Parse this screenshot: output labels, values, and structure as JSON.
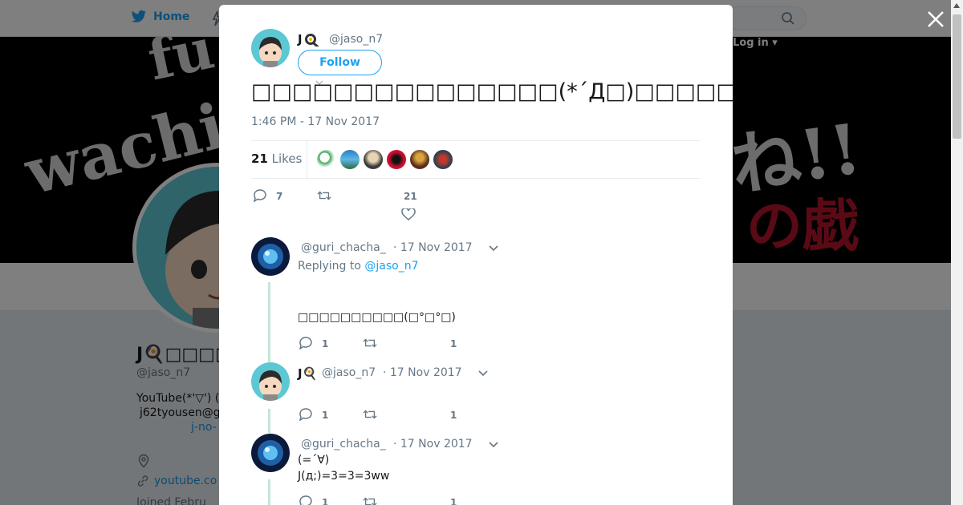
{
  "topbar": {
    "home_label": "Home",
    "login_label": "Log in"
  },
  "banner": {
    "scribble_1": "wachi",
    "scribble_2": "ね!!",
    "scribble_3": "の戯言",
    "scribble_4": "fu"
  },
  "background_profile": {
    "name": "J",
    "handle": "@jaso_n7",
    "bio_line1": "YouTube(*'▽') (",
    "bio_line2": "j62tyousen@g",
    "link_fragment": "j-no-",
    "url_fragment": "youtube.co",
    "joined_fragment": "Joined Febru"
  },
  "tweet": {
    "author_name": "J",
    "author_handle": "@jaso_n7",
    "follow_label": "Follow",
    "text": "□□□□□□□□□□□□□□□(*´Д□)□□□□□□□□□□□□□□□□□( ˘•ω",
    "timestamp": "1:46 PM - 17 Nov 2017",
    "likes_count": "21",
    "likes_label": "Likes",
    "reply_count": "7",
    "like_count": "21"
  },
  "replies": [
    {
      "handle": "@guri_chacha_",
      "date": "· 17 Nov 2017",
      "replying_prefix": "Replying to",
      "replying_to": "@jaso_n7",
      "text": "□□□□□□□□□□(□°□°□)",
      "reply_count": "1",
      "like_count": "1"
    },
    {
      "name": "J",
      "handle": "@jaso_n7",
      "date": "· 17 Nov 2017",
      "reply_count": "1",
      "like_count": "1"
    },
    {
      "handle": "@guri_chacha_",
      "date": "· 17 Nov 2017",
      "text_line1": "(=´∀)",
      "text_line2": "J(д;)=3=3=3ww",
      "reply_count": "1",
      "like_count": "1"
    }
  ],
  "colors": {
    "accent": "#1da1f2",
    "thread_line": "#c4e6d8",
    "text_secondary": "#657786"
  }
}
